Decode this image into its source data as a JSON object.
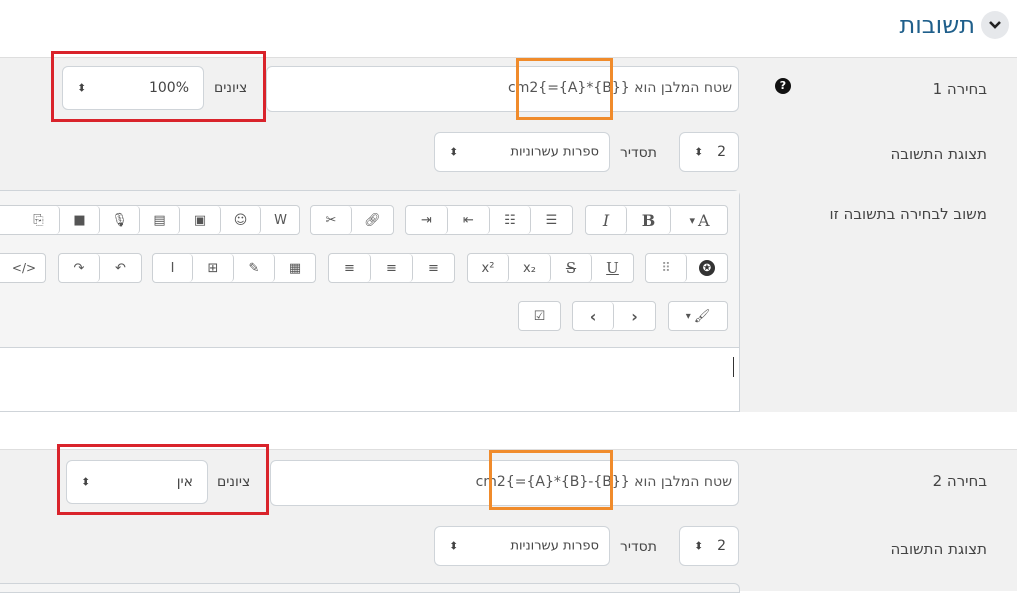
{
  "header": {
    "title": "תשובות",
    "chevron": "chevron-down-icon"
  },
  "choice1": {
    "label": "בחירה 1",
    "help_icon": "question-circle-icon",
    "answer_text_prefix": "שטח המלבן הוא",
    "answer_formula": "{={A}*{B}}",
    "answer_unit": "cm2",
    "grade_label": "ציונים",
    "grade_value": "100%",
    "display_label": "תצוגת התשובה",
    "format_label": "תסדיר",
    "format_value": "ספרות עשרוניות",
    "decimals_value": "2",
    "feedback_label": "משוב לבחירה בתשובה זו"
  },
  "choice2": {
    "label": "בחירה 2",
    "answer_text_prefix": "שטח המלבן הוא",
    "answer_formula": "{={A}*{B}-{B}}",
    "answer_unit": "cm2",
    "grade_label": "ציונים",
    "grade_value": "אין",
    "display_label": "תצוגת התשובה",
    "format_label": "תסדיר",
    "format_value": "ספרות עשרוניות",
    "decimals_value": "2"
  },
  "toolbar": {
    "row1": [
      "font-size-icon",
      "bold-icon",
      "italic-icon",
      "unordered-list-icon",
      "ordered-list-icon",
      "outdent-icon",
      "indent-icon",
      "link-icon",
      "unlink-icon",
      "word-paste-icon",
      "emoji-icon",
      "image-icon",
      "media-icon",
      "record-audio-icon",
      "record-video-icon",
      "manage-files-icon"
    ],
    "row2": [
      "accessibility-checker-icon",
      "screenreader-helper-icon",
      "underline-icon",
      "strikethrough-icon",
      "subscript-icon",
      "superscript-icon",
      "align-left-icon",
      "align-center-icon",
      "align-right-icon",
      "equation-icon",
      "edit-icon",
      "table-icon",
      "clear-formatting-icon",
      "undo-icon",
      "redo-icon",
      "html-icon"
    ],
    "row3": [
      "paint-brush-icon",
      "ltr-icon",
      "rtl-icon",
      "checklist-icon"
    ],
    "labels": {
      "bold": "B",
      "italic": "I",
      "font": "A",
      "underline": "U",
      "strike": "S",
      "sub": "x₂",
      "sup": "x²"
    }
  },
  "colors": {
    "title": "#1f5f8b",
    "highlight_red": "#d9232b",
    "highlight_orange": "#f08b2b",
    "row_bg": "#f1f1f1"
  }
}
